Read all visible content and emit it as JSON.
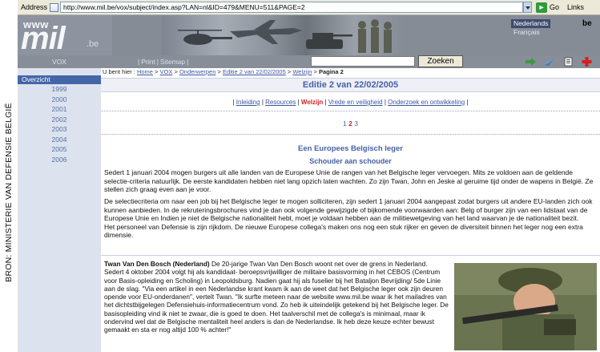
{
  "side_caption": "BRON: MINISTERIE VAN DEFENSIE BELGIË",
  "browser": {
    "address_label": "Address",
    "url": "http://www.mil.be/vox/subject/index.asp?LAN=nl&ID=479&MENU=511&PAGE=2",
    "go_label": "Go",
    "links_label": "Links"
  },
  "header": {
    "logo_www": "www",
    "logo_mil": "mil",
    "logo_be": ".be",
    "lang_nl": "Nederlands",
    "lang_fr": "Français",
    "country_code": "be"
  },
  "nav": {
    "section": "VOX",
    "print": "Print",
    "sitemap": "Sitemap",
    "search_value": "",
    "search_button": "Zoeken"
  },
  "sidebar": {
    "heading": "Overzicht",
    "years": [
      "1999",
      "2000",
      "2001",
      "2002",
      "2003",
      "2004",
      "2005",
      "2006"
    ]
  },
  "breadcrumb": {
    "prefix": "U bent hier :",
    "items": [
      "Home",
      "VOX",
      "Onderwerpen",
      "Editie 2 van 22/02/2005",
      "Welzijn"
    ],
    "current": "Pagina 2"
  },
  "edition_title": "Editie 2 van 22/02/2005",
  "topics": {
    "items": [
      "Inleiding",
      "Resources",
      "Welzijn",
      "Vrede en veiligheid",
      "Onderzoek en ontwikkeling"
    ],
    "active": "Welzijn"
  },
  "pager": {
    "pages": [
      "1",
      "2",
      "3"
    ],
    "current": "2"
  },
  "article": {
    "title": "Een Europees Belgisch leger",
    "subtitle": "Schouder aan schouder",
    "intro": "Sedert 1 januari 2004 mogen burgers uit alle landen van de Europese Unie de rangen van het Belgische leger vervoegen. Mits ze voldoen aan de geldende selectie-criteria natuurlijk. De eerste kandidaten hebben niet lang opzich laten wachten. Zo zijn Twan, John en Jeske al geruime tijd onder de wapens in België. Ze stellen zich graag even aan je voor.",
    "criteria": "De selectiecriteria om naar een job bij het Belgische leger te mogen solliciteren, zijn sedert 1 januari 2004 aangepast zodat burgers uit andere EU-landen zich ook kunnen aanbieden. In de rekruteringsbrochures vind je dan ook volgende gewijzigde of bijkomende voorwaarden aan: Belg of burger zijn van een lidstaat van de Europese Unie en Indien je niet de Belgische nationaliteit hebt, moet je voldaan hebben aan de militiewetgeving van het land waarvan je de nationaliteit bezit.",
    "criteria_2": "Het personeel van Defensie is zijn rijkdom. De nieuwe Europese collega's maken ons nog een stuk rijker en geven de diversiteit binnen het leger nog een extra dimensie.",
    "profile_name": "Twan Van Den Bosch (Nederland)",
    "profile_text": " De 20-jarige Twan Van Den Bosch woont net over de grens in Nederland. Sedert 4 oktober 2004 volgt hij als kandidaat- beroepsvrijwilliger de militaire basisvorming in het CEBOS (Centrum voor Basis-opleiding en Scholing) in Leopoldsburg. Nadien gaat hij als fuselier bij het Bataljon Bevrijding/ 5de Linie aan de slag. \"Via een artikel in een Nederlandse krant kwam ik aan de weet dat het Belgische leger ook zijn deuren opende voor EU-onderdanen\", vertelt Twan. \"Ik surfte meteen naar de website www.mil.be waar ik het mailadres van het dichtstbijgelegen Defensiehuis-informatiecentrum vond. Zo heb ik uiteindelijk getekend bij het Belgische leger. De basisopleiding vind ik niet te zwaar, die is goed te doen. Het taalverschil met de collega's is minimaal, maar ik ondervind wel dat de Belgische mentaliteit heel anders is dan de Nederlandse. Ik heb deze keuze echter bewust gemaakt en sta er nog altijd 100 % achter!\""
  }
}
